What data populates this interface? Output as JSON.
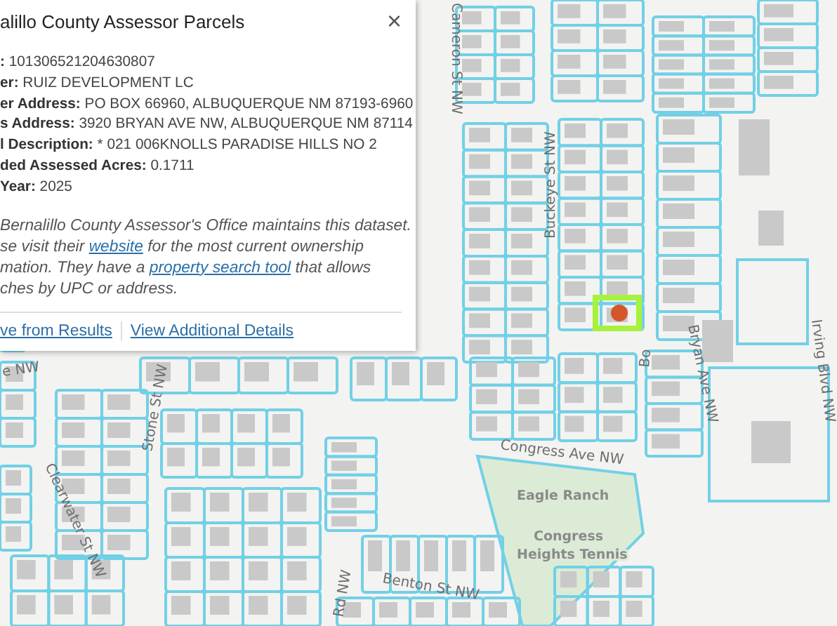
{
  "popup": {
    "title": "alillo County Assessor Parcels",
    "close": "×",
    "fields": [
      {
        "label": ":",
        "value": "101306521204630807"
      },
      {
        "label": "er:",
        "value": "RUIZ DEVELOPMENT LC"
      },
      {
        "label": "er Address:",
        "value": "PO BOX 66960, ALBUQUERQUE NM 87193-6960"
      },
      {
        "label": "s Address:",
        "value": "3920 BRYAN AVE NW, ALBUQUERQUE NM 87114"
      },
      {
        "label": "l Description:",
        "value": "* 021 006KNOLLS PARADISE HILLS NO 2"
      },
      {
        "label": "ded Assessed Acres:",
        "value": "0.1711"
      },
      {
        "label": "Year:",
        "value": "2025"
      }
    ],
    "note_lines": [
      [
        {
          "text": "Bernalillo County Assessor's Office maintains this dataset.",
          "link": false
        }
      ],
      [
        {
          "text": "se visit their ",
          "link": false
        },
        {
          "text": "website",
          "link": true
        },
        {
          "text": " for the most current ownership",
          "link": false
        }
      ],
      [
        {
          "text": "mation. They have a ",
          "link": false
        },
        {
          "text": "property search tool",
          "link": true
        },
        {
          "text": " that allows",
          "link": false
        }
      ],
      [
        {
          "text": "ches by UPC or address.",
          "link": false
        }
      ]
    ],
    "actions": [
      "ve from Results",
      "View Additional Details"
    ]
  },
  "map": {
    "street_labels": [
      "Cameron St NW",
      "Buckeye St NW",
      "Bryan Ave NW",
      "Irving Blvd NW",
      "e NW",
      "Stone St NW",
      "Clearwater St NW",
      "Congress Ave NW",
      "Benton St NW",
      "Rd NW",
      "Bo"
    ],
    "place_labels": [
      "Eagle Ranch",
      "Congress",
      "Heights Tennis"
    ]
  }
}
